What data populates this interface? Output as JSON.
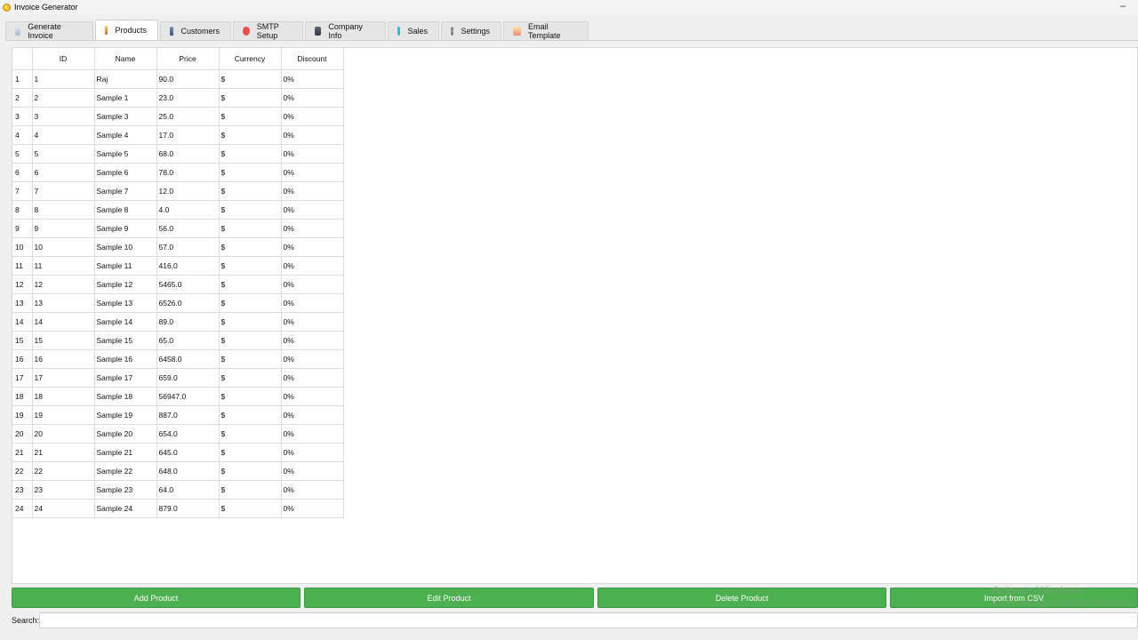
{
  "window": {
    "title": "Invoice Generator",
    "minimize_glyph": "–"
  },
  "tabs": [
    {
      "label": "Generate Invoice",
      "icon": "document-icon"
    },
    {
      "label": "Products",
      "icon": "boxes-icon"
    },
    {
      "label": "Customers",
      "icon": "person-icon"
    },
    {
      "label": "SMTP Setup",
      "icon": "red-circle-icon"
    },
    {
      "label": "Company Info",
      "icon": "building-icon"
    },
    {
      "label": "Sales",
      "icon": "chart-icon"
    },
    {
      "label": "Settings",
      "icon": "gear-icon"
    },
    {
      "label": "Email Template",
      "icon": "envelope-icon"
    }
  ],
  "active_tab": "Products",
  "table": {
    "columns": [
      "ID",
      "Name",
      "Price",
      "Currency",
      "Discount"
    ],
    "rows": [
      [
        "1",
        "Raj",
        "90.0",
        "$",
        "0%"
      ],
      [
        "2",
        "Sample 1",
        "23.0",
        "$",
        "0%"
      ],
      [
        "3",
        "Sample 3",
        "25.0",
        "$",
        "0%"
      ],
      [
        "4",
        "Sample 4",
        "17.0",
        "$",
        "0%"
      ],
      [
        "5",
        "Sample 5",
        "68.0",
        "$",
        "0%"
      ],
      [
        "6",
        "Sample 6",
        "78.0",
        "$",
        "0%"
      ],
      [
        "7",
        "Sample 7",
        "12.0",
        "$",
        "0%"
      ],
      [
        "8",
        "Sample 8",
        "4.0",
        "$",
        "0%"
      ],
      [
        "9",
        "Sample 9",
        "56.0",
        "$",
        "0%"
      ],
      [
        "10",
        "Sample 10",
        "57.0",
        "$",
        "0%"
      ],
      [
        "11",
        "Sample 11",
        "416.0",
        "$",
        "0%"
      ],
      [
        "12",
        "Sample 12",
        "5465.0",
        "$",
        "0%"
      ],
      [
        "13",
        "Sample 13",
        "6526.0",
        "$",
        "0%"
      ],
      [
        "14",
        "Sample 14",
        "89.0",
        "$",
        "0%"
      ],
      [
        "15",
        "Sample 15",
        "65.0",
        "$",
        "0%"
      ],
      [
        "16",
        "Sample 16",
        "6458.0",
        "$",
        "0%"
      ],
      [
        "17",
        "Sample 17",
        "659.0",
        "$",
        "0%"
      ],
      [
        "18",
        "Sample 18",
        "56947.0",
        "$",
        "0%"
      ],
      [
        "19",
        "Sample 19",
        "887.0",
        "$",
        "0%"
      ],
      [
        "20",
        "Sample 20",
        "654.0",
        "$",
        "0%"
      ],
      [
        "21",
        "Sample 21",
        "645.0",
        "$",
        "0%"
      ],
      [
        "22",
        "Sample 22",
        "648.0",
        "$",
        "0%"
      ],
      [
        "23",
        "Sample 23",
        "64.0",
        "$",
        "0%"
      ],
      [
        "24",
        "Sample 24",
        "879.0",
        "$",
        "0%"
      ]
    ]
  },
  "buttons": {
    "add": "Add Product",
    "edit": "Edit Product",
    "delete": "Delete Product",
    "import": "Import from CSV"
  },
  "search": {
    "label": "Search:",
    "value": ""
  },
  "watermark": {
    "line1": "Activate Windows",
    "line2": "Go to Settings to activate Windows."
  },
  "colors": {
    "button_green": "#4caf50",
    "background": "#f0f0f0"
  }
}
